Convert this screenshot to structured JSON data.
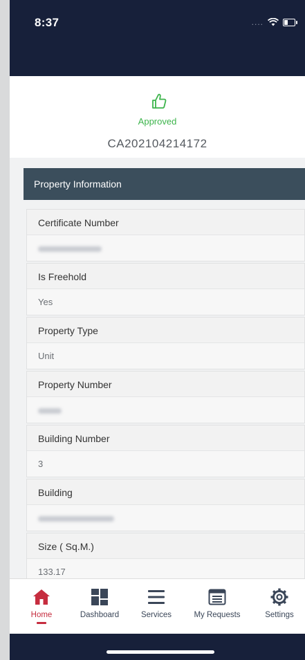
{
  "status_bar": {
    "time": "8:37",
    "signal_text": "....",
    "wifi_icon": "wifi-icon",
    "battery_icon": "battery-icon"
  },
  "approval": {
    "icon": "thumbs-up-icon",
    "status": "Approved",
    "status_color": "#3cb44b",
    "application_number": "CA202104214172"
  },
  "section": {
    "title": "Property Information"
  },
  "fields": [
    {
      "label": "Certificate Number",
      "value": "",
      "redacted": true
    },
    {
      "label": "Is Freehold",
      "value": "Yes"
    },
    {
      "label": "Property Type",
      "value": "Unit"
    },
    {
      "label": "Property Number",
      "value": "",
      "redacted": true
    },
    {
      "label": "Building Number",
      "value": "3"
    },
    {
      "label": "Building",
      "value": "",
      "redacted": true
    },
    {
      "label": "Size ( Sq.M.)",
      "value": "133.17"
    }
  ],
  "tabs": [
    {
      "label": "Home",
      "icon": "home-icon",
      "active": true
    },
    {
      "label": "Dashboard",
      "icon": "dashboard-icon"
    },
    {
      "label": "Services",
      "icon": "menu-icon"
    },
    {
      "label": "My Requests",
      "icon": "requests-icon"
    },
    {
      "label": "Settings",
      "icon": "gear-icon"
    }
  ],
  "colors": {
    "header_bg": "#17203a",
    "section_header_bg": "#3b4e5c",
    "active_tab": "#c62d3f",
    "tab_icon": "#3a4658"
  }
}
